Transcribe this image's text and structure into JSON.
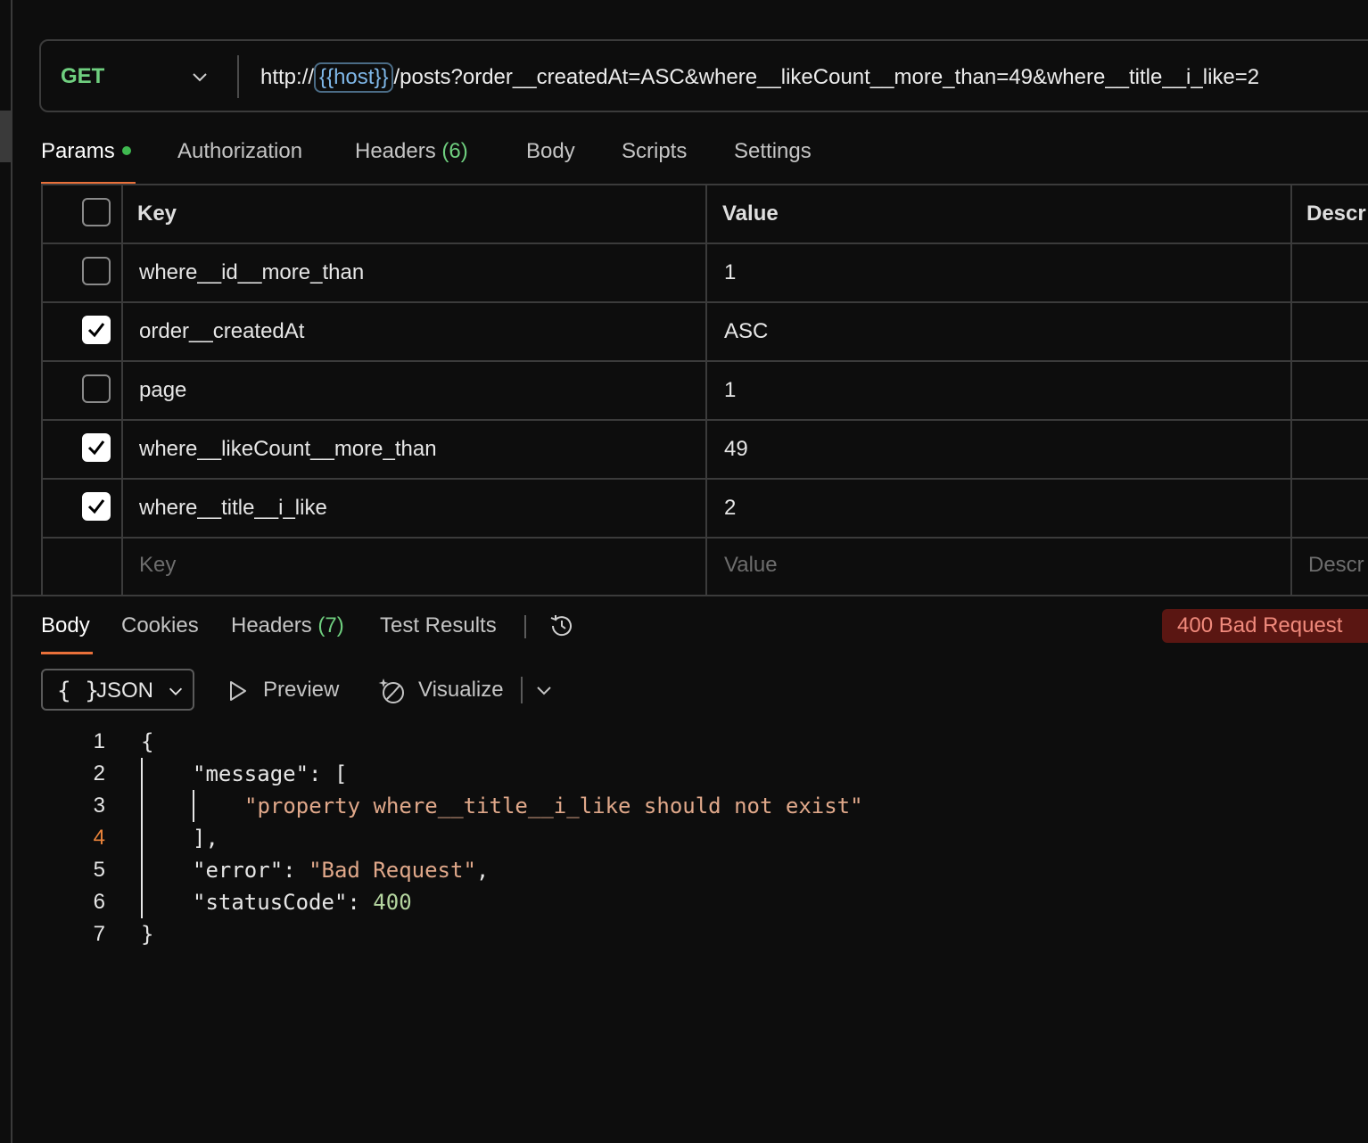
{
  "request": {
    "method": "GET",
    "url_prefix": "http://",
    "url_variable": "{{host}}",
    "url_suffix": "/posts?order__createdAt=ASC&where__likeCount__more_than=49&where__title__i_like=2"
  },
  "request_tabs": {
    "params": "Params",
    "authorization": "Authorization",
    "headers": "Headers",
    "headers_count": "(6)",
    "body": "Body",
    "scripts": "Scripts",
    "settings": "Settings"
  },
  "params_table": {
    "headers": {
      "key": "Key",
      "value": "Value",
      "description": "Descr"
    },
    "rows": [
      {
        "key": "where__id__more_than",
        "value": "1",
        "checked": false
      },
      {
        "key": "order__createdAt",
        "value": "ASC",
        "checked": true
      },
      {
        "key": "page",
        "value": "1",
        "checked": false
      },
      {
        "key": "where__likeCount__more_than",
        "value": "49",
        "checked": true
      },
      {
        "key": "where__title__i_like",
        "value": "2",
        "checked": true
      }
    ],
    "placeholders": {
      "key": "Key",
      "value": "Value",
      "description": "Descr"
    }
  },
  "response_tabs": {
    "body": "Body",
    "cookies": "Cookies",
    "headers": "Headers",
    "headers_count": "(7)",
    "test_results": "Test Results"
  },
  "status": {
    "text": "400 Bad Request",
    "color": "#5a1612"
  },
  "format": {
    "braces": "{ }",
    "selected": "JSON",
    "preview": "Preview",
    "visualize": "Visualize"
  },
  "code": {
    "line_numbers": [
      "1",
      "2",
      "3",
      "4",
      "5",
      "6",
      "7"
    ],
    "current_line": "4",
    "open_brace": "{",
    "message_key": "\"message\"",
    "message_open": ": [",
    "message_value": "\"property where__title__i_like should not exist\"",
    "message_close": "],",
    "error_key": "\"error\"",
    "error_value": "\"Bad Request\"",
    "status_key": "\"statusCode\"",
    "status_value": "400",
    "close_brace": "}"
  },
  "icons": [
    "chevron-down-icon",
    "checkbox-icon",
    "check-icon",
    "history-icon",
    "play-icon",
    "visualize-icon"
  ],
  "colors": {
    "method": "#6fcf7f",
    "active_tab_underline": "#e9703a",
    "string": "#e0a88a",
    "number": "#b5d6a0"
  }
}
